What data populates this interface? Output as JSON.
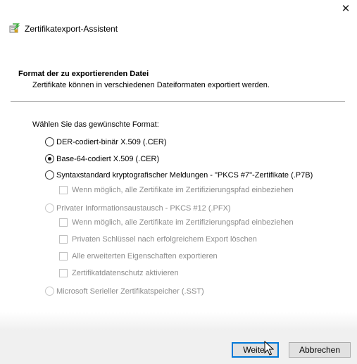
{
  "window": {
    "title": "Zertifikatexport-Assistent",
    "close_label": "✕"
  },
  "header": {
    "heading": "Format der zu exportierenden Datei",
    "description": "Zertifikate können in verschiedenen Dateiformaten exportiert werden."
  },
  "format": {
    "prompt": "Wählen Sie das gewünschte Format:",
    "options": [
      {
        "label": "DER-codiert-binär X.509 (.CER)",
        "selected": false,
        "enabled": true
      },
      {
        "label": "Base-64-codiert X.509 (.CER)",
        "selected": true,
        "enabled": true
      },
      {
        "label": "Syntaxstandard kryptografischer Meldungen - \"PKCS #7\"-Zertifikate (.P7B)",
        "selected": false,
        "enabled": true
      },
      {
        "label": "Privater Informationsaustausch - PKCS #12 (.PFX)",
        "selected": false,
        "enabled": false
      },
      {
        "label": "Microsoft Serieller Zertifikatspeicher (.SST)",
        "selected": false,
        "enabled": false
      }
    ],
    "pkcs7_include_chain": "Wenn möglich, alle Zertifikate im Zertifizierungspfad einbeziehen",
    "pfx_options": [
      "Wenn möglich, alle Zertifikate im Zertifizierungspfad einbeziehen",
      "Privaten Schlüssel nach erfolgreichem Export löschen",
      "Alle erweiterten Eigenschaften exportieren",
      "Zertifikatdatenschutz aktivieren"
    ]
  },
  "buttons": {
    "next": "Weiter",
    "cancel": "Abbrechen"
  },
  "colors": {
    "accent": "#0078d7",
    "disabled_text": "#8c8c8c"
  }
}
